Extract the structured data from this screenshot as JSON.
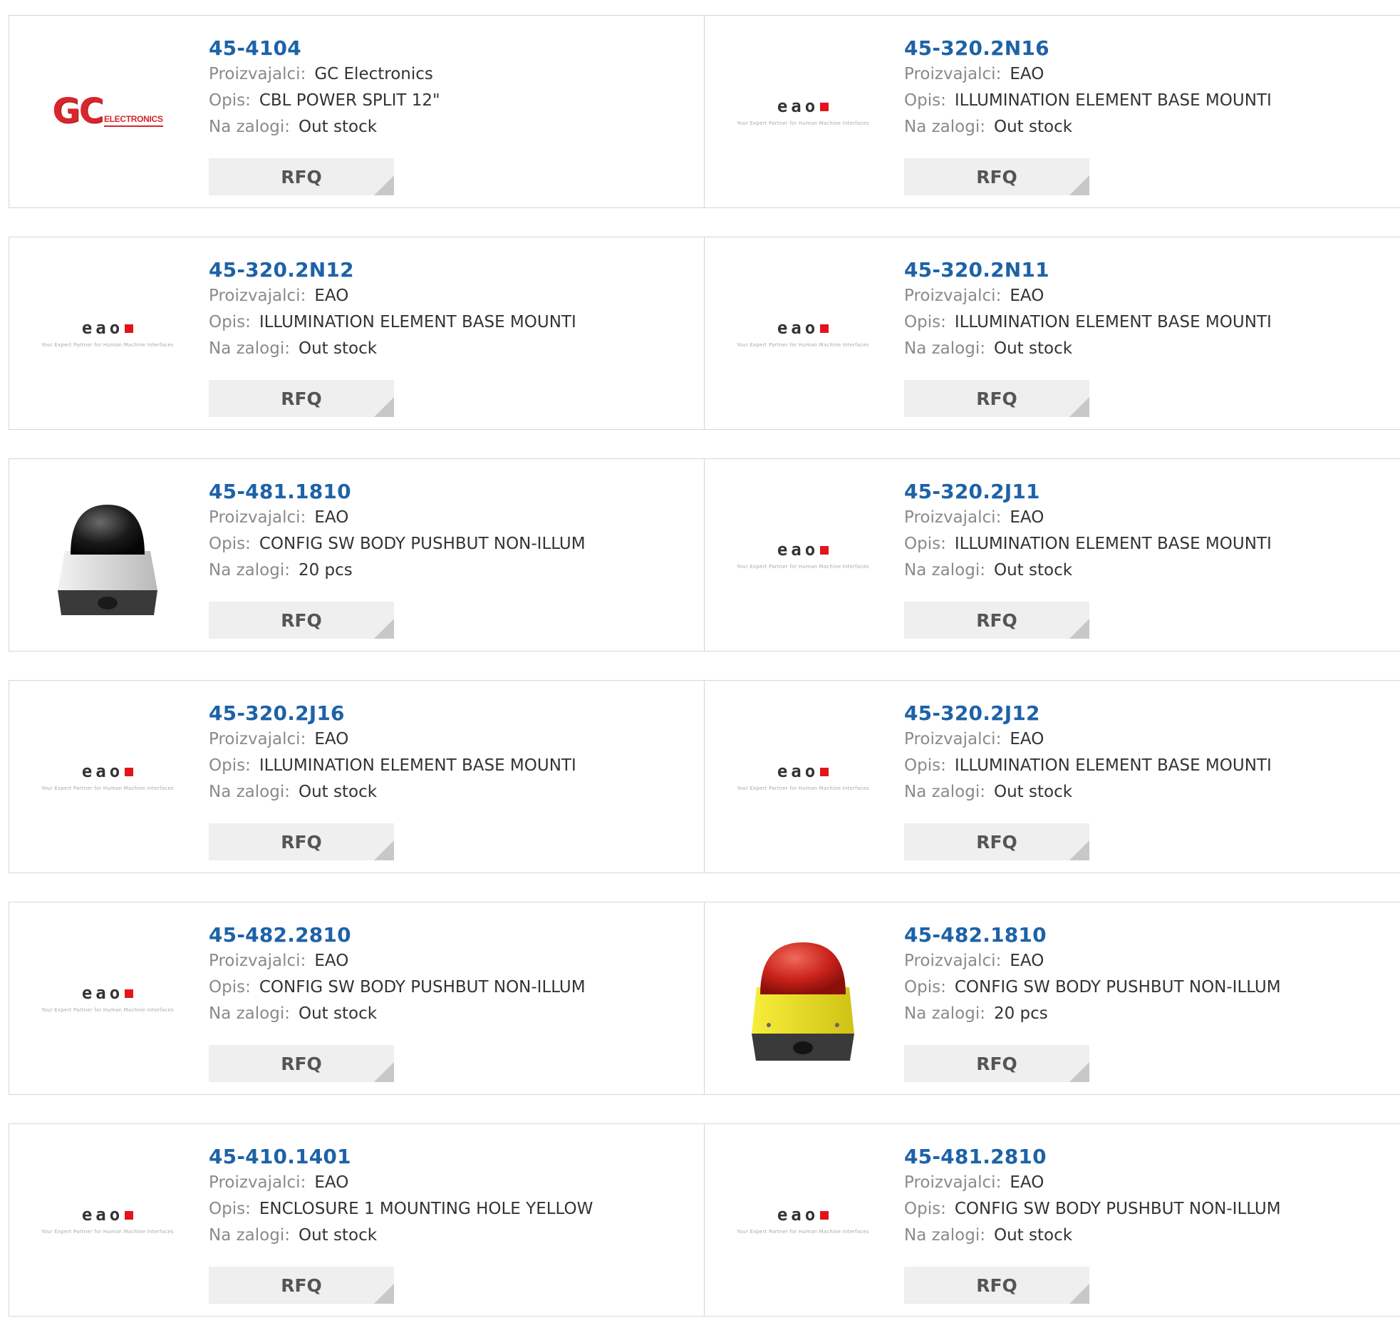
{
  "labels": {
    "manufacturer": "Proizvajalci:",
    "description": "Opis:",
    "stock": "Na zalogi:",
    "rfq": "RFQ"
  },
  "logos": {
    "eao_word": "eao",
    "eao_tagline": "Your Expert Partner for Human Machine Interfaces",
    "gc_big": "GC",
    "gc_small": "ELECTRONICS"
  },
  "colors": {
    "link": "#1d62a8",
    "label": "#8a8a8a",
    "button_bg": "#efefef",
    "eao_red": "#e3141c"
  },
  "products": [
    {
      "part": "45-4104",
      "manufacturer": "GC Electronics",
      "description": "CBL POWER SPLIT 12\"",
      "stock": "Out stock",
      "image": "gc-logo"
    },
    {
      "part": "45-320.2N16",
      "manufacturer": "EAO",
      "description": "ILLUMINATION ELEMENT BASE MOUNTI",
      "stock": "Out stock",
      "image": "eao-logo"
    },
    {
      "part": "45-320.2N12",
      "manufacturer": "EAO",
      "description": "ILLUMINATION ELEMENT BASE MOUNTI",
      "stock": "Out stock",
      "image": "eao-logo"
    },
    {
      "part": "45-320.2N11",
      "manufacturer": "EAO",
      "description": "ILLUMINATION ELEMENT BASE MOUNTI",
      "stock": "Out stock",
      "image": "eao-logo"
    },
    {
      "part": "45-481.1810",
      "manufacturer": "EAO",
      "description": "CONFIG SW BODY PUSHBUT NON-ILLUM",
      "stock": "20 pcs",
      "image": "black-pushbutton"
    },
    {
      "part": "45-320.2J11",
      "manufacturer": "EAO",
      "description": "ILLUMINATION ELEMENT BASE MOUNTI",
      "stock": "Out stock",
      "image": "eao-logo"
    },
    {
      "part": "45-320.2J16",
      "manufacturer": "EAO",
      "description": "ILLUMINATION ELEMENT BASE MOUNTI",
      "stock": "Out stock",
      "image": "eao-logo"
    },
    {
      "part": "45-320.2J12",
      "manufacturer": "EAO",
      "description": "ILLUMINATION ELEMENT BASE MOUNTI",
      "stock": "Out stock",
      "image": "eao-logo"
    },
    {
      "part": "45-482.2810",
      "manufacturer": "EAO",
      "description": "CONFIG SW BODY PUSHBUT NON-ILLUM",
      "stock": "Out stock",
      "image": "eao-logo"
    },
    {
      "part": "45-482.1810",
      "manufacturer": "EAO",
      "description": "CONFIG SW BODY PUSHBUT NON-ILLUM",
      "stock": "20 pcs",
      "image": "red-pushbutton"
    },
    {
      "part": "45-410.1401",
      "manufacturer": "EAO",
      "description": "ENCLOSURE 1 MOUNTING HOLE YELLOW",
      "stock": "Out stock",
      "image": "eao-logo"
    },
    {
      "part": "45-481.2810",
      "manufacturer": "EAO",
      "description": "CONFIG SW BODY PUSHBUT NON-ILLUM",
      "stock": "Out stock",
      "image": "eao-logo"
    }
  ]
}
